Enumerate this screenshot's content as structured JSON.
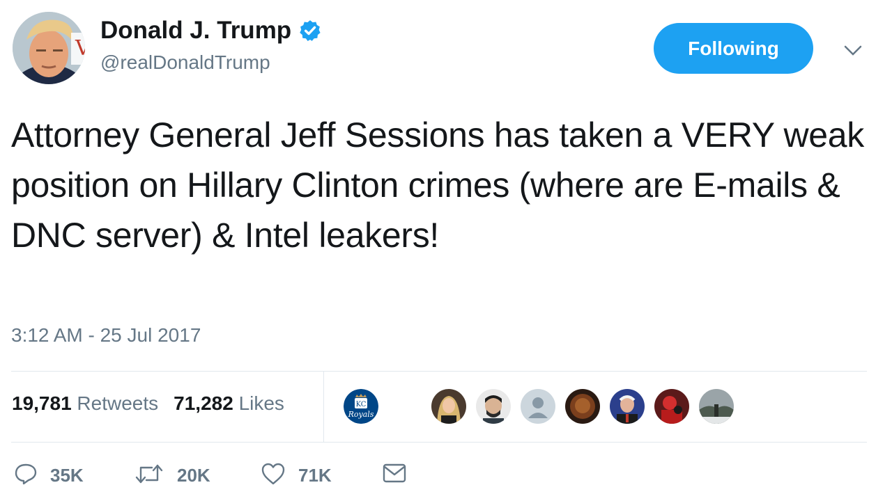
{
  "author": {
    "display_name": "Donald J. Trump",
    "handle": "@realDonaldTrump",
    "verified": true,
    "verified_color": "#1da1f2"
  },
  "header": {
    "follow_label": "Following",
    "menu_icon": "chevron-down-icon"
  },
  "tweet": {
    "text": "Attorney General Jeff Sessions has taken a VERY weak position on Hillary Clinton crimes (where are E-mails & DNC server) & Intel leakers!",
    "timestamp": "3:12 AM - 25 Jul 2017"
  },
  "stats": {
    "retweets_count": "19,781",
    "retweets_label": "Retweets",
    "likes_count": "71,282",
    "likes_label": "Likes"
  },
  "likers": {
    "badge_text": "KC Royals",
    "badge_color": "#004687",
    "avatar_count": 7
  },
  "actions": {
    "reply_count": "35K",
    "retweet_count": "20K",
    "like_count": "71K",
    "message_icon": "envelope-icon"
  }
}
